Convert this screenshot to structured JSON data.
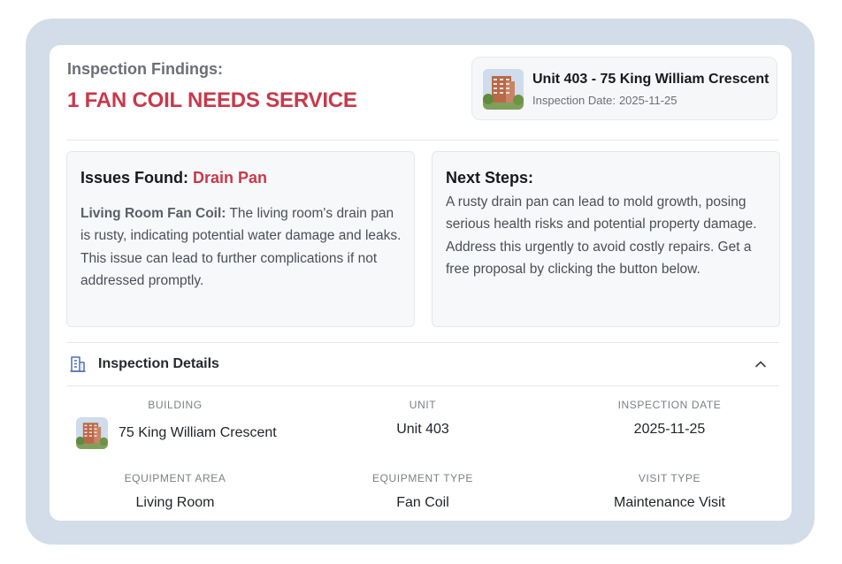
{
  "findings": {
    "label": "Inspection Findings:",
    "title": "1 FAN COIL NEEDS SERVICE"
  },
  "unit_card": {
    "title": "Unit 403 - 75 King William Crescent",
    "date_label": "Inspection Date:",
    "date_value": "2025-11-25"
  },
  "issues": {
    "heading": "Issues Found:",
    "issue": "Drain Pan",
    "lead": "Living Room Fan Coil:",
    "text": "The living room's drain pan is rusty, indicating potential water damage and leaks. This issue can lead to further complications if not addressed promptly."
  },
  "next_steps": {
    "heading": "Next Steps:",
    "text": "A rusty drain pan can lead to mold growth, posing serious health risks and potential property damage. Address this urgently to avoid costly repairs. Get a free proposal by clicking the button below."
  },
  "details": {
    "title": "Inspection Details",
    "fields": [
      {
        "label": "BUILDING",
        "value": "75 King William Crescent"
      },
      {
        "label": "UNIT",
        "value": "Unit 403"
      },
      {
        "label": "INSPECTION DATE",
        "value": "2025-11-25"
      },
      {
        "label": "EQUIPMENT AREA",
        "value": "Living Room"
      },
      {
        "label": "EQUIPMENT TYPE",
        "value": "Fan Coil"
      },
      {
        "label": "VISIT TYPE",
        "value": "Maintenance Visit"
      }
    ]
  },
  "icons": {
    "building": "building-icon",
    "collapse": "chevron-up-icon"
  },
  "colors": {
    "accent_red": "#c8394a",
    "frame_blue": "#d3dde9",
    "icon_blue": "#4f6fb5"
  }
}
